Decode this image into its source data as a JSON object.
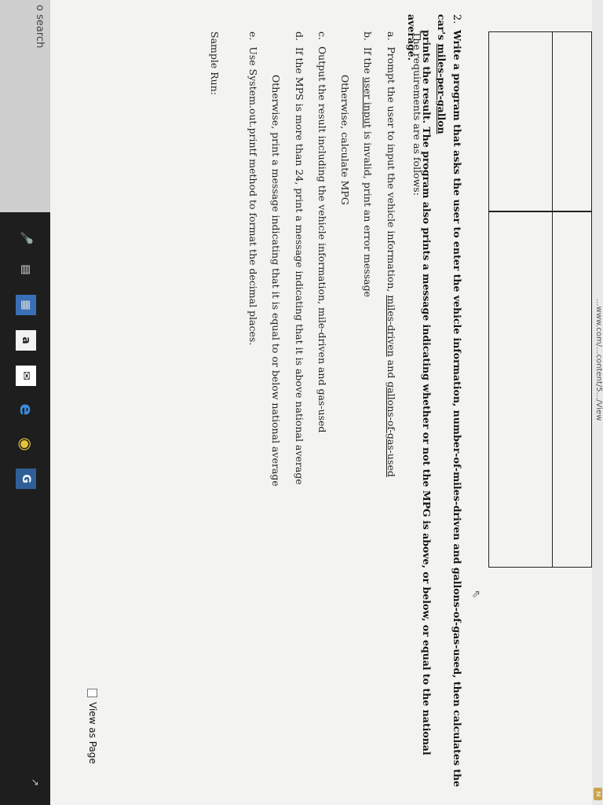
{
  "browser": {
    "url": "...www.com/...content/5.../View",
    "ext_label": "M"
  },
  "question": {
    "number": "2.",
    "line1_pre": "Write a program that asks the user to enter the vehicle information, number-of-miles-driven and gallons-of-gas-used, then calculates the car's ",
    "line1_ul": "miles-per-gallon",
    "line2": "prints the result. The program also prints a message indicating whether or not the MPG is above, or below, or equal to the national average."
  },
  "requirements": {
    "intro": "The requirements are as follows:",
    "a_label": "a.",
    "a_pre": "Prompt the user to input the vehicle information, ",
    "a_ul1": "miles-driven",
    "a_mid": " and ",
    "a_ul2": "gallons-of-gas-used",
    "b_label": "b.",
    "b_pre": "If the ",
    "b_ul": "user input",
    "b_post": " is invalid, print an error message",
    "b_other": "Otherwise, calculate MPG",
    "c_label": "c.",
    "c_text": "Output the result including the vehicle information, mile-driven and gas-used",
    "d_label": "d.",
    "d_text": "If the MPS is more than 24, print a message indicating that it is above national average",
    "d_other": "Otherwise, print a message indicating that it is equal to or below national average",
    "e_label": "e.",
    "e_text": "Use System.out.printf method to format the decimal places.",
    "sample": "Sample Run:"
  },
  "view_as_page": "View as Page",
  "taskbar": {
    "search_placeholder": "o search",
    "icons": [
      "mic-icon",
      "task-view-icon",
      "store-icon",
      "amazon-icon",
      "mail-icon",
      "edge-icon",
      "chrome-icon",
      "g-app-icon"
    ]
  }
}
